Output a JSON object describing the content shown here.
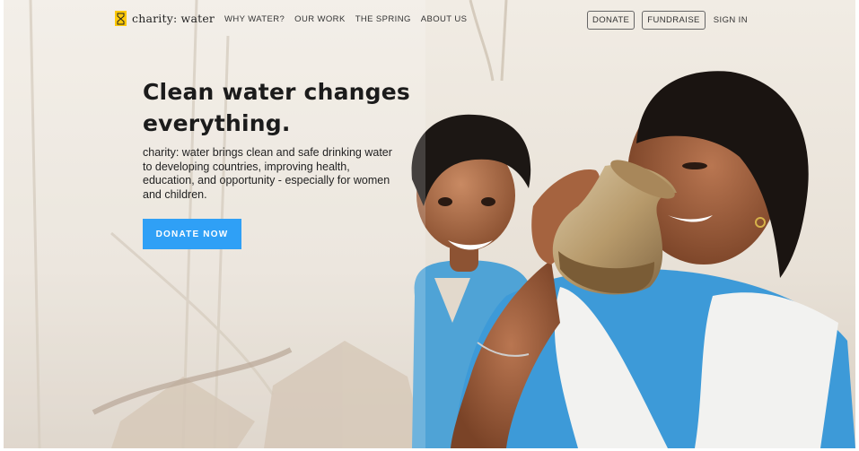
{
  "brand": {
    "logo_text": "charity: water",
    "logo_color": "#ffc907"
  },
  "nav": {
    "items": [
      {
        "label": "WHY WATER?"
      },
      {
        "label": "OUR WORK"
      },
      {
        "label": "THE SPRING"
      },
      {
        "label": "ABOUT US"
      }
    ],
    "donate_label": "DONATE",
    "fundraise_label": "FUNDRAISE",
    "signin_label": "SIGN IN"
  },
  "hero": {
    "headline_line1": "Clean water changes",
    "headline_line2": "everything.",
    "body": "charity: water brings clean and safe drinking water to developing countries, improving health, education, and opportunity - especially for women and children.",
    "cta_label": "DONATE NOW",
    "cta_color": "#2fa0f6",
    "image_icon": "children-drinking-water-photo"
  }
}
